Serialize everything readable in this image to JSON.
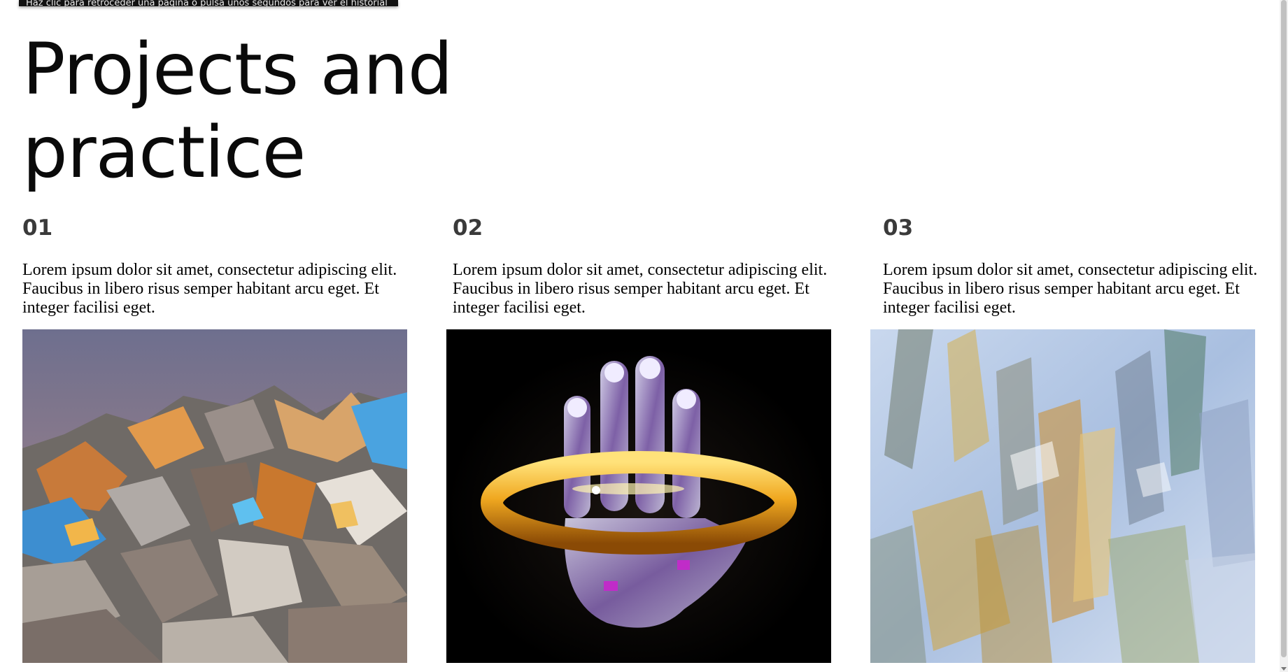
{
  "tooltip": {
    "text": "Haz clic para retroceder una página o pulsa unos segundos para ver el historial"
  },
  "page": {
    "title": "Projects and practice"
  },
  "projects": [
    {
      "number": "01",
      "description": "Lorem ipsum dolor sit amet, consectetur adipiscing elit. Faucibus in libero risus semper habitant arcu eget. Et integer facilisi eget.",
      "image": "crumpled-iridescent-foil-image"
    },
    {
      "number": "02",
      "description": "Lorem ipsum dolor sit amet, consectetur adipiscing elit. Faucibus in libero risus semper habitant arcu eget. Et integer facilisi eget.",
      "image": "glass-hand-gold-ring-image"
    },
    {
      "number": "03",
      "description": "Lorem ipsum dolor sit amet, consectetur adipiscing elit. Faucibus in libero risus semper habitant arcu eget. Et integer facilisi eget.",
      "image": "blurred-crystal-shards-image"
    }
  ],
  "colors": {
    "background": "#ffffff",
    "title": "#0a0a0a",
    "number": "#3a3a3a"
  }
}
